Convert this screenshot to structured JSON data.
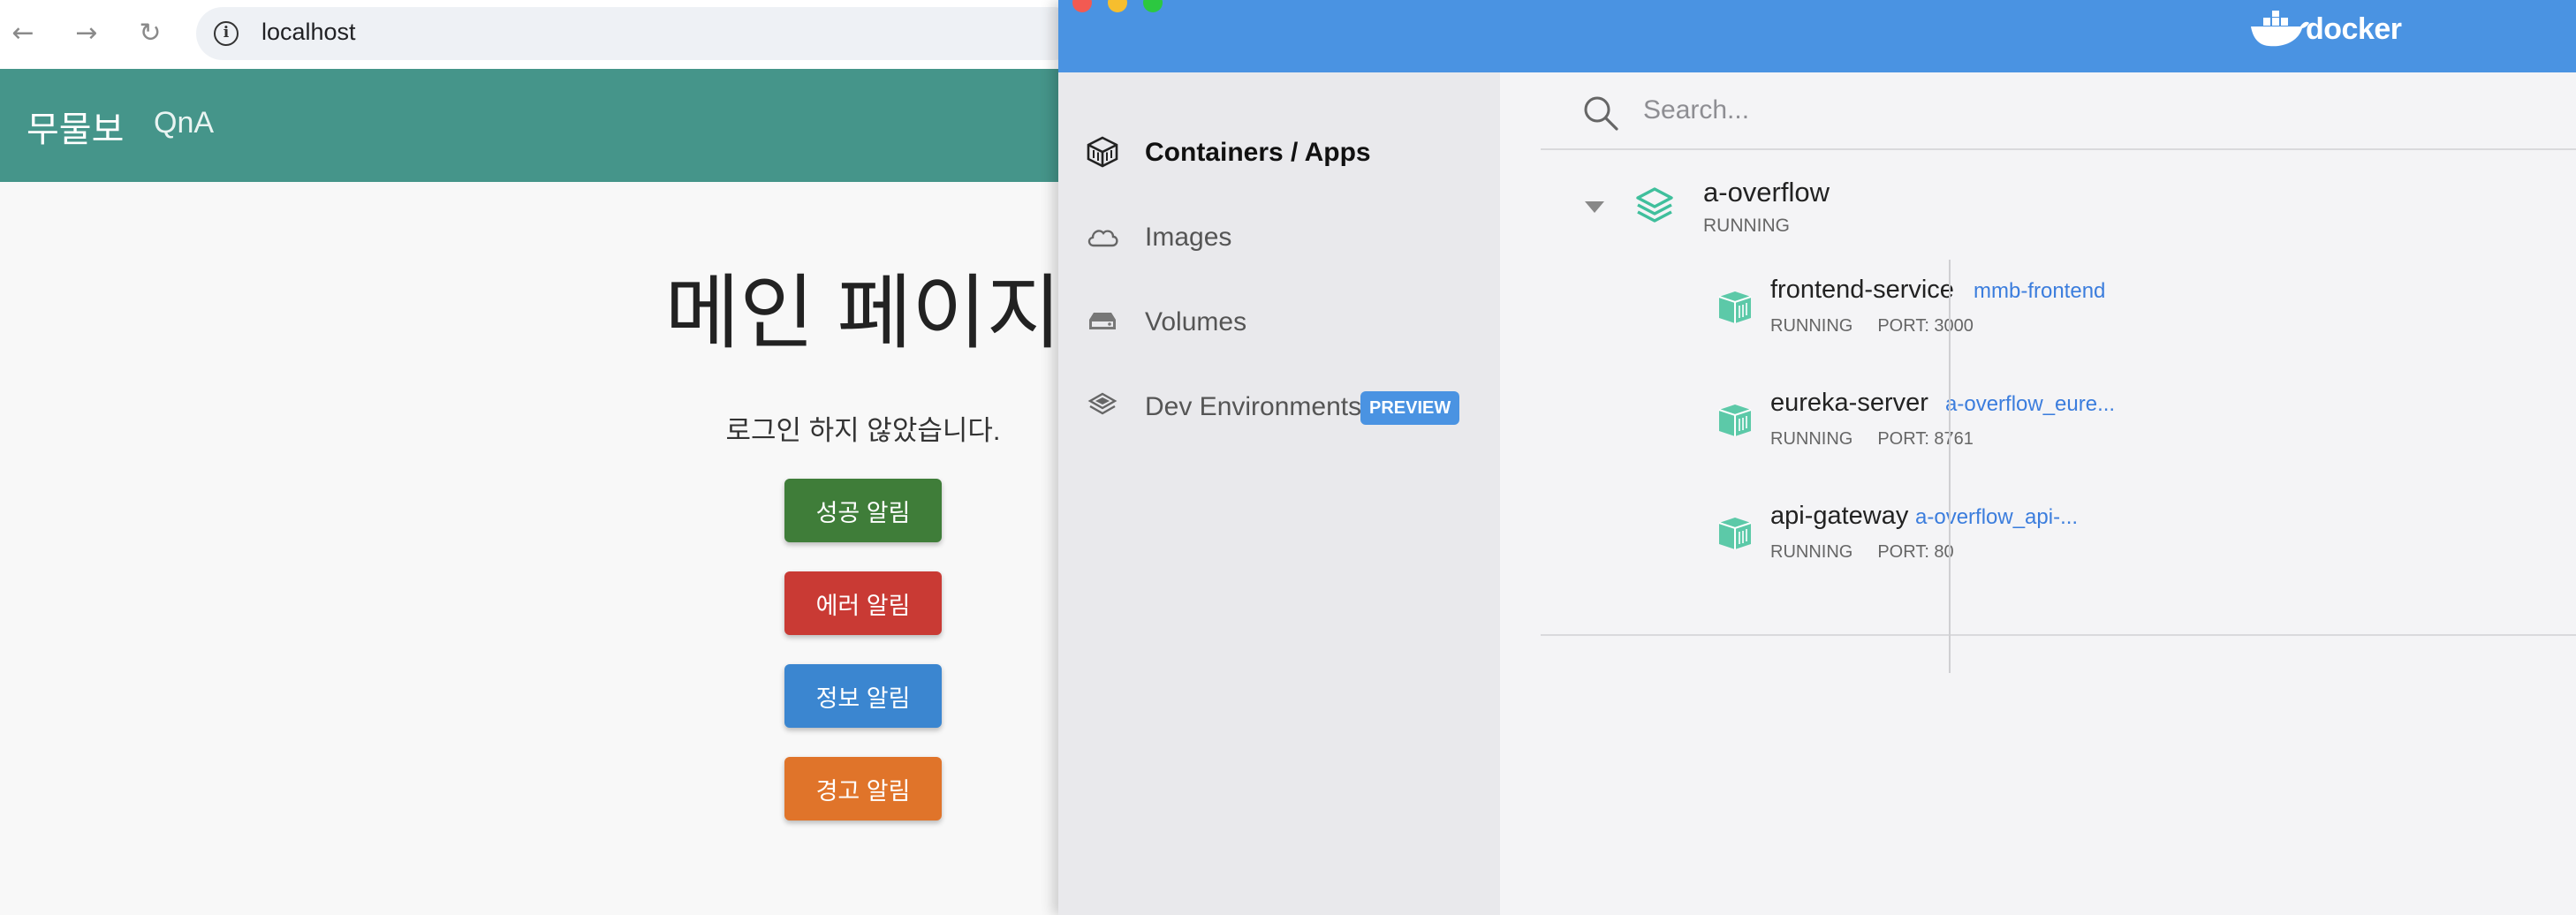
{
  "browser": {
    "back_glyph": "←",
    "forward_glyph": "→",
    "reload_glyph": "↻",
    "info_glyph": "i",
    "url": "localhost"
  },
  "app": {
    "brand": "무물보",
    "nav_link": "QnA",
    "page_title": "메인 페이지",
    "login_status": "로그인 하지 않았습니다.",
    "buttons": {
      "success": "성공 알림",
      "error": "에러 알림",
      "info": "정보 알림",
      "warning": "경고 알림"
    },
    "colors": {
      "navbar": "#45958a",
      "success": "#3f7d39",
      "error": "#c93a34",
      "info": "#3b86d0",
      "warning": "#e0742a"
    }
  },
  "docker": {
    "logo_text": "docker",
    "accent_color": "#4a93e2",
    "sidebar": {
      "items": [
        {
          "label": "Containers / Apps",
          "icon": "containers-icon",
          "active": true
        },
        {
          "label": "Images",
          "icon": "cloud-icon",
          "active": false
        },
        {
          "label": "Volumes",
          "icon": "volume-icon",
          "active": false
        },
        {
          "label": "Dev Environments",
          "icon": "dev-environments-icon",
          "active": false,
          "badge": "PREVIEW"
        }
      ]
    },
    "search": {
      "placeholder": "Search..."
    },
    "app_group": {
      "name": "a-overflow",
      "status": "RUNNING",
      "services": [
        {
          "name": "frontend-service",
          "image": "mmb-frontend",
          "status": "RUNNING",
          "port": "PORT: 3000"
        },
        {
          "name": "eureka-server",
          "image": "a-overflow_eure...",
          "status": "RUNNING",
          "port": "PORT: 8761"
        },
        {
          "name": "api-gateway",
          "image": "a-overflow_api-...",
          "status": "RUNNING",
          "port": "PORT: 80"
        }
      ]
    }
  }
}
